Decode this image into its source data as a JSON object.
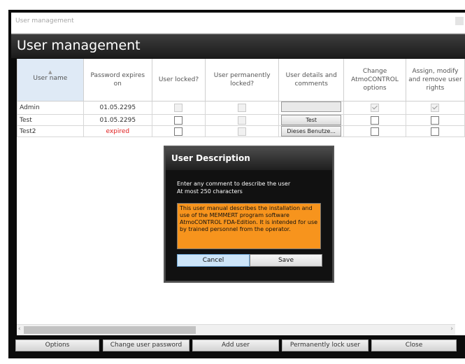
{
  "window": {
    "title": "User management"
  },
  "header": {
    "title": "User management"
  },
  "table": {
    "columns": [
      "User name",
      "Password expires on",
      "User locked?",
      "User permanently locked?",
      "User details and comments",
      "Change AtmoCONTROL options",
      "Assign, modify and remove user rights"
    ],
    "rows": [
      {
        "name": "Admin",
        "expires": "01.05.2295",
        "details": ""
      },
      {
        "name": "Test",
        "expires": "01.05.2295",
        "details": "Test"
      },
      {
        "name": "Test2",
        "expires": "expired",
        "details": "Dieses Benutze..."
      }
    ]
  },
  "footer": {
    "options": "Options",
    "change_password": "Change user password",
    "add_user": "Add user",
    "permanently_lock": "Permanently lock user",
    "close": "Close"
  },
  "dialog": {
    "title": "User Description",
    "line1": "Enter any comment to describe the user",
    "line2": "At most 250 characters",
    "text": "This user manual describes the installation and use of the MEMMERT program software AtmoCONTROL FDA-Edition. It is intended for use by trained personnel from the operator.",
    "cancel": "Cancel",
    "save": "Save"
  },
  "colors": {
    "accent": "#f7941d",
    "expired": "#e02020",
    "selected_button": "#cde5f8"
  }
}
